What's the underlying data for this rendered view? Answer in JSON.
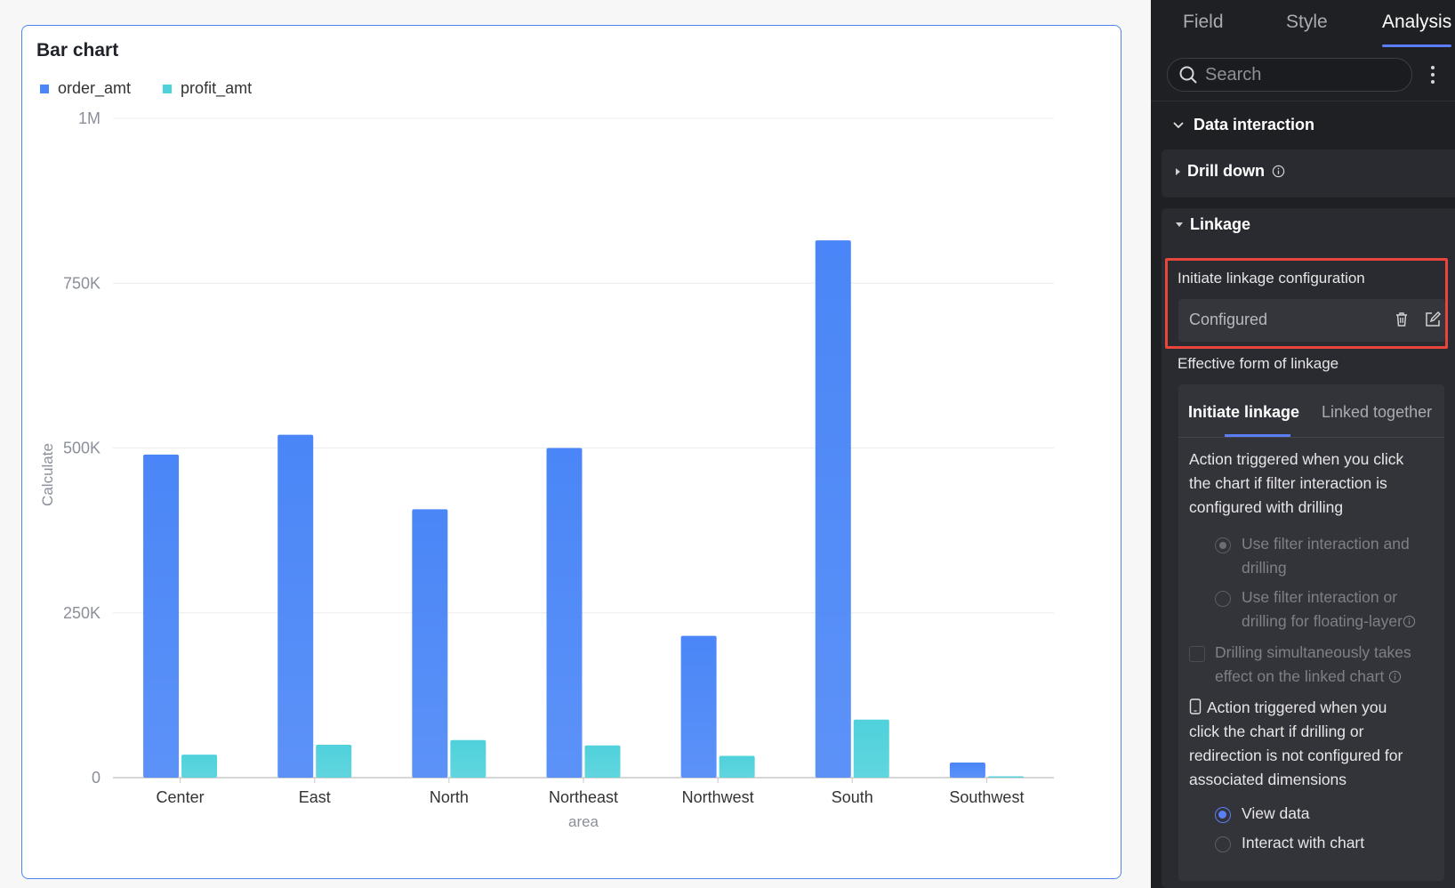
{
  "chart": {
    "title": "Bar chart",
    "legend": [
      {
        "label": "order_amt",
        "color": "#4a86f7"
      },
      {
        "label": "profit_amt",
        "color": "#4fd1db"
      }
    ]
  },
  "chart_data": {
    "type": "bar",
    "title": "Bar chart",
    "xlabel": "area",
    "ylabel": "Calculate",
    "ylim": [
      0,
      1000000
    ],
    "y_ticks": [
      {
        "value": 0,
        "label": "0"
      },
      {
        "value": 250000,
        "label": "250K"
      },
      {
        "value": 500000,
        "label": "500K"
      },
      {
        "value": 750000,
        "label": "750K"
      },
      {
        "value": 1000000,
        "label": "1M"
      }
    ],
    "grid": true,
    "legend_position": "top-left",
    "categories": [
      "Center",
      "East",
      "North",
      "Northeast",
      "Northwest",
      "South",
      "Southwest"
    ],
    "series": [
      {
        "name": "order_amt",
        "color": "#4a86f7",
        "values": [
          490000,
          520000,
          407000,
          500000,
          215000,
          815000,
          23000
        ]
      },
      {
        "name": "profit_amt",
        "color": "#4fd1db",
        "values": [
          35000,
          50000,
          57000,
          49000,
          33000,
          88000,
          2000
        ]
      }
    ]
  },
  "panel": {
    "tabs": [
      "Field",
      "Style",
      "Analysis"
    ],
    "active_tab": "Analysis",
    "search": {
      "placeholder": "Search"
    },
    "section_title": "Data interaction",
    "drill_down": "Drill down",
    "linkage": {
      "title": "Linkage",
      "initiate_config_label": "Initiate linkage configuration",
      "configured_text": "Configured",
      "effective_form_label": "Effective form of linkage",
      "inner_tabs": [
        "Initiate linkage",
        "Linked together"
      ],
      "para1_lines": [
        "Action triggered when you click",
        "the chart if filter interaction is",
        "configured with drilling"
      ],
      "option1_lines": [
        "Use filter interaction and",
        "drilling"
      ],
      "option2_lines": [
        "Use filter interaction or",
        "drilling for floating-layer"
      ],
      "checkbox_lines": [
        "Drilling simultaneously takes",
        "effect on the linked chart"
      ],
      "para2_lines": [
        "Action triggered when you",
        "click the chart if drilling or",
        "redirection is not configured for",
        "associated dimensions"
      ],
      "option_view": "View data",
      "option_interact": "Interact with chart"
    }
  }
}
